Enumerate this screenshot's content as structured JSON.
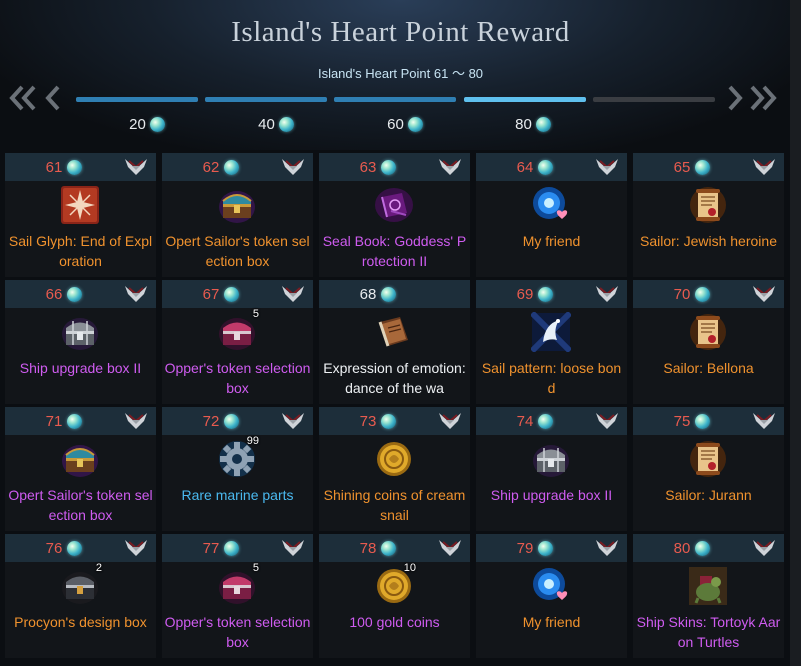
{
  "header": {
    "title": "Island's Heart Point Reward",
    "subtitle": "Island's Heart Point 61 ～ 80"
  },
  "colors": {
    "point_number": "#e85b4f",
    "legendary": "#f0922e",
    "epic": "#cf5cf0",
    "rare": "#4ab9ef",
    "common": "#eef1f4",
    "progress_filled": "#2f7fb3",
    "progress_active": "#5fc0ee"
  },
  "progress": [
    {
      "fill": 1.0
    },
    {
      "fill": 1.0
    },
    {
      "fill": 1.0
    },
    {
      "fill": 1.0,
      "active": true
    },
    {
      "fill": 0.0
    }
  ],
  "milestones": [
    "20",
    "40",
    "60",
    "80"
  ],
  "rewards": [
    {
      "point": "61",
      "name": "Sail Glyph: End of Exploration",
      "grade": "orange",
      "icon": "compass-glyph-icon",
      "qty": ""
    },
    {
      "point": "62",
      "name": "Opert Sailor's token selection box",
      "grade": "orange",
      "icon": "treasure-chest-icon",
      "qty": ""
    },
    {
      "point": "63",
      "name": "Seal Book: Goddess' Protection II",
      "grade": "purple",
      "icon": "seal-book-icon",
      "qty": ""
    },
    {
      "point": "64",
      "name": "My friend",
      "grade": "orange",
      "icon": "friend-orb-icon",
      "qty": ""
    },
    {
      "point": "65",
      "name": "Sailor: Jewish heroine",
      "grade": "orange",
      "icon": "scroll-contract-icon",
      "qty": ""
    },
    {
      "point": "66",
      "name": "Ship upgrade box II",
      "grade": "purple",
      "icon": "silver-chest-icon",
      "qty": ""
    },
    {
      "point": "67",
      "name": "Opper's token selection box",
      "grade": "purple",
      "icon": "pink-chest-icon",
      "qty": "5"
    },
    {
      "point": "68",
      "name": "Expression of emotion: dance of the wa",
      "grade": "white",
      "icon": "emote-book-icon",
      "qty": ""
    },
    {
      "point": "69",
      "name": "Sail pattern: loose bond",
      "grade": "orange",
      "icon": "sail-pattern-icon",
      "qty": ""
    },
    {
      "point": "70",
      "name": "Sailor: Bellona",
      "grade": "orange",
      "icon": "scroll-contract-icon",
      "qty": ""
    },
    {
      "point": "71",
      "name": "Opert Sailor's token selection box",
      "grade": "purple",
      "icon": "treasure-chest-icon",
      "qty": ""
    },
    {
      "point": "72",
      "name": "Rare marine parts",
      "grade": "blue",
      "icon": "gear-icon",
      "qty": "99"
    },
    {
      "point": "73",
      "name": "Shining coins of cream snail",
      "grade": "orange",
      "icon": "gold-coin-icon",
      "qty": ""
    },
    {
      "point": "74",
      "name": "Ship upgrade box II",
      "grade": "purple",
      "icon": "silver-chest-icon",
      "qty": ""
    },
    {
      "point": "75",
      "name": "Sailor: Jurann",
      "grade": "orange",
      "icon": "scroll-contract-icon",
      "qty": ""
    },
    {
      "point": "76",
      "name": "Procyon's design box",
      "grade": "orange",
      "icon": "dark-chest-icon",
      "qty": "2"
    },
    {
      "point": "77",
      "name": "Opper's token selection box",
      "grade": "purple",
      "icon": "pink-chest-icon",
      "qty": "5"
    },
    {
      "point": "78",
      "name": "100 gold coins",
      "grade": "purple",
      "icon": "gold-coin-icon",
      "qty": "10"
    },
    {
      "point": "79",
      "name": "My friend",
      "grade": "orange",
      "icon": "friend-orb-icon",
      "qty": ""
    },
    {
      "point": "80",
      "name": "Ship Skins: Tortoyk Aaron Turtles",
      "grade": "purple",
      "icon": "turtle-skin-icon",
      "qty": ""
    }
  ]
}
